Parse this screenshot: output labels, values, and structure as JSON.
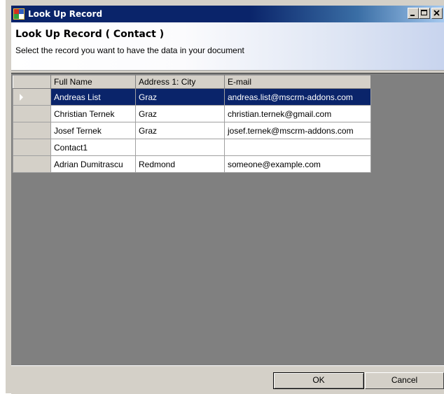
{
  "window": {
    "title": "Look Up Record",
    "controls": {
      "minimize": "_",
      "maximize": "□",
      "close": "✕"
    },
    "titlebar_color": "#0a246a"
  },
  "header": {
    "title": "Look Up Record ( Contact )",
    "subtitle": "Select the record you want to have the data in your document"
  },
  "grid": {
    "columns": [
      "Full Name",
      "Address 1: City",
      "E-mail"
    ],
    "selected_row": 0,
    "selection_color": "#0a246a",
    "rows": [
      {
        "full_name": "Andreas List",
        "city": "Graz",
        "email": "andreas.list@mscrm-addons.com"
      },
      {
        "full_name": "Christian Ternek",
        "city": "Graz",
        "email": "christian.ternek@gmail.com"
      },
      {
        "full_name": "Josef Ternek",
        "city": "Graz",
        "email": "josef.ternek@mscrm-addons.com"
      },
      {
        "full_name": "Contact1",
        "city": "",
        "email": ""
      },
      {
        "full_name": "Adrian Dumitrascu",
        "city": "Redmond",
        "email": "someone@example.com"
      }
    ]
  },
  "buttons": {
    "ok": "OK",
    "cancel": "Cancel"
  }
}
